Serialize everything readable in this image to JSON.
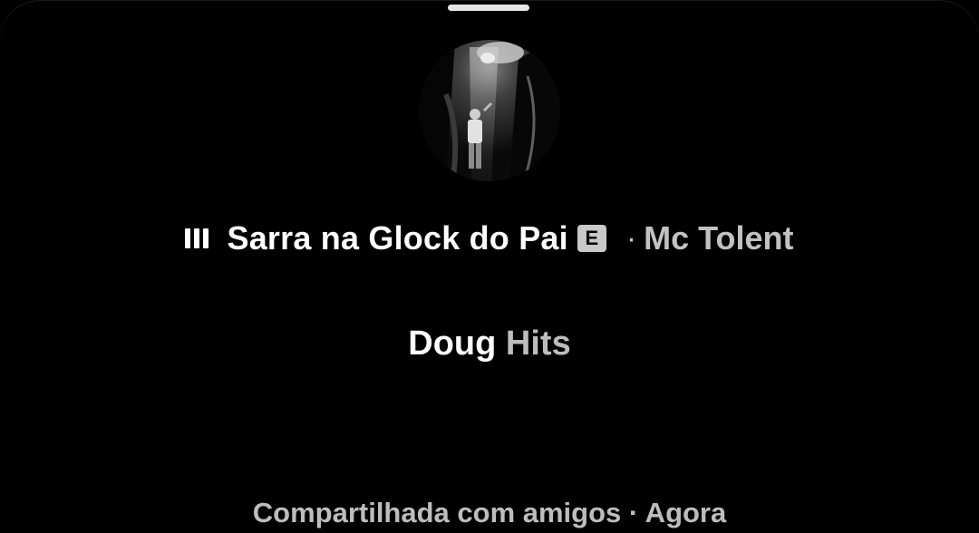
{
  "now_playing": {
    "icon": "equalizer-bars-icon",
    "title": "Sarra na Glock do Pai",
    "explicit_badge": "E",
    "separator": "·",
    "artist": "Mc Tolent"
  },
  "owner": {
    "name": "Doug",
    "suffix": "Hits"
  },
  "footer": {
    "shared_text": "Compartilhada com amigos · Agora"
  },
  "colors": {
    "background": "#000000",
    "primary_text": "#ffffff",
    "secondary_text": "#bdbdbd"
  }
}
